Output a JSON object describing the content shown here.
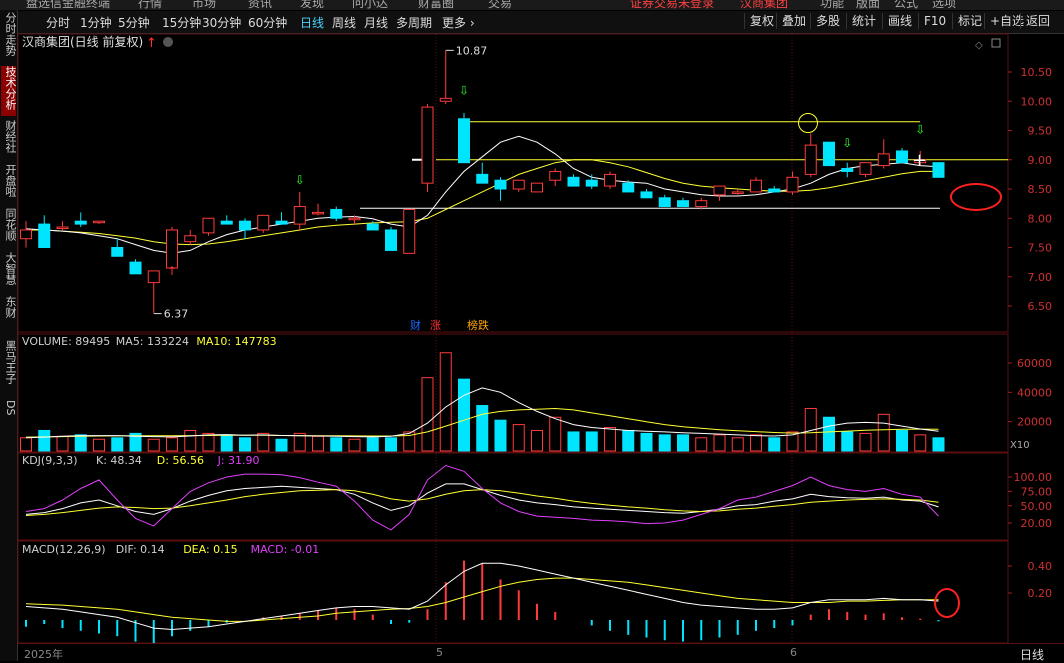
{
  "topbar": {
    "items": [
      "盘选信金融终端",
      "行情",
      "市场",
      "资讯",
      "发现",
      "问小达",
      "财富圈",
      "交易",
      "证券交易未登录",
      "汉商集团",
      "功能",
      "版面",
      "公式",
      "选项"
    ]
  },
  "toolbar": {
    "periods": [
      "分时",
      "1分钟",
      "5分钟",
      "15分钟",
      "30分钟",
      "60分钟",
      "日线",
      "周线",
      "月线",
      "多周期",
      "更多"
    ],
    "active_period": "日线",
    "right_buttons": [
      "复权",
      "叠加",
      "多股",
      "统计",
      "画线",
      "F10",
      "标记",
      "+自选",
      "返回"
    ]
  },
  "leftnav": {
    "items": [
      "分时走势",
      "技术分析",
      "财经社",
      "开盘啦",
      "同花顺",
      "大智慧",
      "东财",
      "黑马王子",
      "DS"
    ],
    "active": "技术分析"
  },
  "colors": {
    "up": "#ff3b3b",
    "down": "#00e5ff",
    "ma5": "#ffffff",
    "ma10": "#ffff33",
    "kdj_j": "#e040fb",
    "grid": "#5a1010"
  },
  "chart_data": [
    {
      "type": "candlestick",
      "title": "汉商集团(日线 前复权)",
      "ylim": [
        6.2,
        10.85
      ],
      "yticks": [
        "6.50",
        "7.00",
        "7.50",
        "8.00",
        "8.50",
        "9.00",
        "9.50",
        "10.00",
        "10.50"
      ],
      "max_label": "10.87",
      "min_label": "6.37",
      "candles": [
        [
          7.65,
          7.95,
          7.5,
          7.8
        ],
        [
          7.9,
          8.05,
          7.5,
          7.5
        ],
        [
          7.85,
          7.95,
          7.8,
          7.85
        ],
        [
          7.95,
          8.1,
          7.85,
          7.9
        ],
        [
          7.95,
          7.95,
          7.9,
          7.95
        ],
        [
          7.5,
          7.65,
          7.35,
          7.35
        ],
        [
          7.25,
          7.3,
          7.05,
          7.05
        ],
        [
          6.9,
          7.1,
          6.38,
          7.1
        ],
        [
          7.15,
          7.85,
          7.15,
          7.8
        ],
        [
          7.6,
          7.8,
          7.55,
          7.7
        ],
        [
          7.75,
          8.0,
          7.7,
          8.0
        ],
        [
          7.95,
          8.05,
          7.9,
          7.9
        ],
        [
          7.95,
          8.0,
          7.65,
          7.8
        ],
        [
          7.8,
          8.05,
          7.75,
          8.05
        ],
        [
          7.95,
          8.1,
          7.9,
          7.9
        ],
        [
          7.9,
          8.45,
          7.8,
          8.2
        ],
        [
          8.1,
          8.25,
          8.05,
          8.1
        ],
        [
          8.15,
          8.2,
          7.95,
          8.0
        ],
        [
          8.0,
          8.05,
          7.9,
          8.0
        ],
        [
          7.9,
          7.95,
          7.8,
          7.8
        ],
        [
          7.8,
          7.85,
          7.45,
          7.45
        ],
        [
          7.4,
          8.15,
          7.4,
          8.15
        ],
        [
          8.6,
          9.95,
          8.45,
          9.9
        ],
        [
          10.0,
          10.87,
          9.95,
          10.05
        ],
        [
          9.7,
          9.8,
          8.95,
          8.95
        ],
        [
          8.75,
          8.95,
          8.6,
          8.6
        ],
        [
          8.65,
          8.7,
          8.3,
          8.5
        ],
        [
          8.5,
          8.65,
          8.45,
          8.65
        ],
        [
          8.45,
          8.6,
          8.45,
          8.6
        ],
        [
          8.65,
          8.85,
          8.55,
          8.8
        ],
        [
          8.7,
          8.75,
          8.55,
          8.55
        ],
        [
          8.65,
          8.75,
          8.5,
          8.55
        ],
        [
          8.55,
          8.8,
          8.5,
          8.75
        ],
        [
          8.6,
          8.65,
          8.45,
          8.45
        ],
        [
          8.45,
          8.5,
          8.35,
          8.35
        ],
        [
          8.35,
          8.4,
          8.2,
          8.2
        ],
        [
          8.3,
          8.35,
          8.2,
          8.2
        ],
        [
          8.2,
          8.35,
          8.15,
          8.3
        ],
        [
          8.4,
          8.55,
          8.3,
          8.55
        ],
        [
          8.45,
          8.5,
          8.4,
          8.45
        ],
        [
          8.45,
          8.7,
          8.45,
          8.65
        ],
        [
          8.5,
          8.55,
          8.45,
          8.45
        ],
        [
          8.45,
          8.8,
          8.4,
          8.7
        ],
        [
          8.75,
          9.45,
          8.7,
          9.25
        ],
        [
          9.3,
          9.3,
          8.9,
          8.9
        ],
        [
          8.85,
          8.95,
          8.7,
          8.8
        ],
        [
          8.75,
          8.95,
          8.7,
          8.95
        ],
        [
          8.9,
          9.35,
          8.85,
          9.1
        ],
        [
          9.15,
          9.2,
          8.95,
          8.95
        ],
        [
          8.95,
          9.15,
          8.9,
          9.0
        ],
        [
          8.95,
          8.95,
          8.7,
          8.7
        ]
      ],
      "ma5": [
        7.82,
        7.8,
        7.78,
        7.75,
        7.7,
        7.65,
        7.55,
        7.45,
        7.4,
        7.45,
        7.6,
        7.72,
        7.8,
        7.85,
        7.9,
        7.95,
        8.0,
        8.02,
        8.03,
        7.99,
        7.9,
        7.85,
        8.05,
        8.45,
        8.8,
        9.05,
        9.3,
        9.4,
        9.3,
        9.1,
        8.85,
        8.7,
        8.65,
        8.62,
        8.6,
        8.5,
        8.45,
        8.4,
        8.38,
        8.38,
        8.4,
        8.45,
        8.5,
        8.6,
        8.75,
        8.85,
        8.9,
        8.92,
        8.95,
        8.9,
        8.88
      ],
      "ma10": [
        7.8,
        7.8,
        7.78,
        7.76,
        7.74,
        7.7,
        7.66,
        7.6,
        7.56,
        7.55,
        7.56,
        7.6,
        7.65,
        7.7,
        7.75,
        7.8,
        7.85,
        7.88,
        7.9,
        7.92,
        7.93,
        7.94,
        8.0,
        8.15,
        8.3,
        8.45,
        8.6,
        8.75,
        8.85,
        8.95,
        9.0,
        9.0,
        8.95,
        8.88,
        8.78,
        8.68,
        8.6,
        8.55,
        8.52,
        8.5,
        8.48,
        8.46,
        8.46,
        8.48,
        8.52,
        8.58,
        8.64,
        8.7,
        8.76,
        8.8,
        8.8
      ],
      "hlines": [
        9.65,
        9.0,
        8.17
      ],
      "annotations": [
        "财",
        "涨",
        "榜跌"
      ]
    },
    {
      "type": "bar",
      "title": "VOLUME",
      "legend": [
        {
          "label": "VOLUME: 89495",
          "color": "#d0d0d0"
        },
        {
          "label": "MA5: 133224",
          "color": "#d0d0d0"
        },
        {
          "label": "MA10: 147783",
          "color": "#ffff33"
        }
      ],
      "ylim": [
        0,
        72000
      ],
      "yticks": [
        "20000",
        "40000",
        "60000"
      ],
      "unit_label": "X10",
      "values": [
        9000,
        14000,
        10000,
        11000,
        8000,
        9000,
        12000,
        8000,
        9000,
        14000,
        12000,
        11000,
        9000,
        12000,
        8000,
        12000,
        10000,
        9000,
        8000,
        9000,
        9000,
        13000,
        50000,
        67000,
        49000,
        31000,
        21000,
        18000,
        14000,
        23000,
        13000,
        13000,
        16000,
        14000,
        12000,
        11000,
        11000,
        9000,
        11000,
        9000,
        11000,
        9000,
        13000,
        29000,
        23000,
        13000,
        12000,
        25000,
        14000,
        11000,
        9000
      ],
      "ma5": [
        9000,
        9500,
        10000,
        10500,
        10500,
        10500,
        10000,
        9800,
        9600,
        10200,
        11000,
        11200,
        10800,
        11000,
        10600,
        10400,
        10200,
        10000,
        9800,
        9600,
        10000,
        12000,
        19000,
        30000,
        38000,
        43000,
        40000,
        33000,
        27000,
        22000,
        18000,
        16000,
        15000,
        14000,
        13500,
        13000,
        12500,
        12000,
        11500,
        11000,
        10500,
        10200,
        11000,
        14000,
        17000,
        19000,
        19500,
        19000,
        17000,
        15000,
        13400
      ],
      "ma10": [
        9500,
        9600,
        9800,
        10000,
        10200,
        10300,
        10400,
        10400,
        10400,
        10500,
        10600,
        10700,
        10700,
        10700,
        10600,
        10500,
        10400,
        10400,
        10300,
        10200,
        10200,
        10600,
        13000,
        17000,
        21000,
        25000,
        27000,
        28000,
        28500,
        29000,
        28000,
        26000,
        24000,
        22000,
        20000,
        18000,
        16500,
        15500,
        14500,
        13800,
        13200,
        12600,
        12200,
        12400,
        13000,
        13600,
        14200,
        14500,
        14800,
        14900,
        14800
      ]
    },
    {
      "type": "line",
      "title": "KDJ(9,3,3)",
      "legend": [
        {
          "label": "KDJ(9,3,3)",
          "color": "#d0d0d0"
        },
        {
          "label": "K: 48.34",
          "color": "#d0d0d0"
        },
        {
          "label": "D: 56.56",
          "color": "#ffff33"
        },
        {
          "label": "J: 31.90",
          "color": "#e040fb"
        }
      ],
      "ylim": [
        0,
        115
      ],
      "yticks": [
        "20.00",
        "50.00",
        "75.00",
        "100.00"
      ],
      "series": [
        {
          "name": "K",
          "values": [
            35,
            38,
            45,
            55,
            60,
            50,
            40,
            35,
            45,
            58,
            68,
            76,
            80,
            82,
            84,
            82,
            80,
            78,
            70,
            55,
            42,
            50,
            72,
            88,
            88,
            78,
            68,
            60,
            55,
            52,
            48,
            46,
            44,
            42,
            40,
            38,
            37,
            40,
            44,
            50,
            52,
            58,
            62,
            70,
            66,
            64,
            63,
            65,
            60,
            58,
            48
          ]
        },
        {
          "name": "D",
          "values": [
            33,
            35,
            38,
            42,
            46,
            48,
            47,
            45,
            46,
            50,
            55,
            60,
            66,
            70,
            73,
            76,
            77,
            78,
            76,
            70,
            62,
            58,
            62,
            70,
            76,
            78,
            76,
            72,
            67,
            63,
            58,
            54,
            51,
            48,
            46,
            43,
            41,
            40,
            41,
            44,
            46,
            49,
            52,
            56,
            58,
            60,
            61,
            62,
            61,
            60,
            56
          ]
        },
        {
          "name": "J",
          "values": [
            40,
            45,
            60,
            80,
            95,
            60,
            28,
            15,
            45,
            75,
            90,
            100,
            105,
            105,
            104,
            99,
            91,
            84,
            58,
            25,
            8,
            35,
            95,
            120,
            110,
            80,
            55,
            40,
            32,
            30,
            28,
            25,
            24,
            22,
            19,
            20,
            25,
            35,
            45,
            60,
            65,
            75,
            85,
            100,
            85,
            78,
            75,
            80,
            70,
            65,
            32
          ]
        }
      ]
    },
    {
      "type": "bar",
      "title": "MACD(12,26,9)",
      "legend": [
        {
          "label": "MACD(12,26,9)",
          "color": "#d0d0d0"
        },
        {
          "label": "DIF: 0.14",
          "color": "#d0d0d0"
        },
        {
          "label": "DEA: 0.15",
          "color": "#ffff33"
        },
        {
          "label": "MACD: -0.01",
          "color": "#e040fb"
        }
      ],
      "ylim": [
        -0.2,
        0.48
      ],
      "yticks": [
        "0.20",
        "0.40"
      ],
      "macd": [
        -0.05,
        -0.03,
        -0.06,
        -0.08,
        -0.1,
        -0.12,
        -0.16,
        -0.18,
        -0.12,
        -0.08,
        -0.05,
        -0.02,
        0.0,
        0.02,
        0.03,
        0.05,
        0.07,
        0.09,
        0.08,
        0.04,
        -0.03,
        -0.02,
        0.08,
        0.28,
        0.44,
        0.42,
        0.3,
        0.22,
        0.12,
        0.06,
        0.0,
        -0.04,
        -0.08,
        -0.11,
        -0.13,
        -0.15,
        -0.16,
        -0.15,
        -0.13,
        -0.11,
        -0.08,
        -0.06,
        -0.04,
        0.04,
        0.08,
        0.06,
        0.04,
        0.05,
        0.02,
        0.01,
        -0.01
      ],
      "dif": [
        0.1,
        0.09,
        0.08,
        0.06,
        0.04,
        0.02,
        -0.02,
        -0.06,
        -0.07,
        -0.06,
        -0.05,
        -0.03,
        -0.01,
        0.01,
        0.03,
        0.05,
        0.07,
        0.09,
        0.1,
        0.1,
        0.09,
        0.08,
        0.14,
        0.26,
        0.36,
        0.42,
        0.42,
        0.4,
        0.37,
        0.34,
        0.31,
        0.28,
        0.25,
        0.22,
        0.19,
        0.16,
        0.13,
        0.11,
        0.1,
        0.09,
        0.08,
        0.08,
        0.09,
        0.13,
        0.15,
        0.15,
        0.15,
        0.16,
        0.15,
        0.15,
        0.14
      ],
      "dea": [
        0.12,
        0.115,
        0.11,
        0.1,
        0.09,
        0.08,
        0.06,
        0.04,
        0.02,
        0.01,
        0.0,
        -0.01,
        -0.01,
        0.0,
        0.01,
        0.02,
        0.03,
        0.05,
        0.06,
        0.07,
        0.08,
        0.085,
        0.1,
        0.13,
        0.17,
        0.21,
        0.25,
        0.28,
        0.3,
        0.31,
        0.31,
        0.3,
        0.29,
        0.28,
        0.26,
        0.24,
        0.22,
        0.2,
        0.18,
        0.16,
        0.15,
        0.14,
        0.13,
        0.13,
        0.13,
        0.14,
        0.14,
        0.145,
        0.15,
        0.15,
        0.15
      ]
    }
  ],
  "bottom": {
    "year": "2025年",
    "month5": "5",
    "month6": "6",
    "period": "日线"
  }
}
